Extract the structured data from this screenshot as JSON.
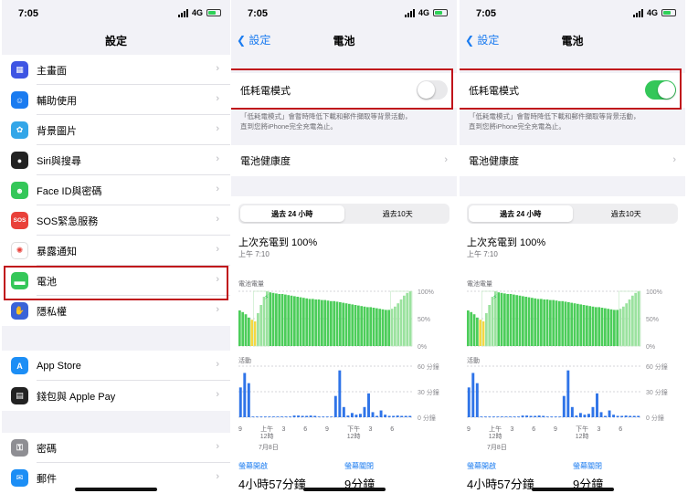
{
  "status": {
    "time": "7:05",
    "network": "4G"
  },
  "settings": {
    "title": "設定",
    "group1": [
      {
        "label": "主畫面",
        "icon": "home-grid-icon",
        "color": "#3f55e3"
      },
      {
        "label": "輔助使用",
        "icon": "accessibility-icon",
        "color": "#1a7bf0"
      },
      {
        "label": "背景圖片",
        "icon": "wallpaper-flower-icon",
        "color": "#33a6e8"
      },
      {
        "label": "Siri與搜尋",
        "icon": "siri-icon",
        "color": "#222"
      },
      {
        "label": "Face ID與密碼",
        "icon": "face-id-icon",
        "color": "#34c759"
      },
      {
        "label": "SOS緊急服務",
        "icon": "sos-icon",
        "color": "#e9413a",
        "glyph": "SOS"
      },
      {
        "label": "暴露通知",
        "icon": "exposure-icon",
        "color": "#ffffff"
      },
      {
        "label": "電池",
        "icon": "battery-icon",
        "color": "#34c759"
      },
      {
        "label": "隱私權",
        "icon": "hand-icon",
        "color": "#3a63d8"
      }
    ],
    "group2": [
      {
        "label": "App Store",
        "icon": "app-store-icon",
        "color": "#1c8ef5"
      },
      {
        "label": "錢包與 Apple Pay",
        "icon": "wallet-icon",
        "color": "#222"
      }
    ],
    "group3": [
      {
        "label": "密碼",
        "icon": "key-icon",
        "color": "#8e8e93"
      },
      {
        "label": "郵件",
        "icon": "mail-icon",
        "color": "#1c8ef5"
      }
    ]
  },
  "battery": {
    "back_label": "設定",
    "title": "電池",
    "low_power_label": "低耗電模式",
    "low_power_note_1": "「低耗電模式」會暫時降低下載和郵件擷取等背景活動，",
    "low_power_note_2": "直到您將iPhone完全充電為止。",
    "health_label": "電池健康度",
    "tab_24h": "過去 24 小時",
    "tab_10d": "過去10天",
    "last_charged": "上次充電到 100%",
    "last_time": "上午 7:10",
    "level_label": "電池電量",
    "activity_label": "活動",
    "level_ticks": [
      "100%",
      "50%",
      "0%"
    ],
    "activity_ticks": [
      "60 分鐘",
      "30 分鐘",
      "0 分鐘"
    ],
    "x_ticks": [
      "9",
      "上午\n12時",
      "3",
      "6",
      "9",
      "下午\n12時",
      "3",
      "6"
    ],
    "date_label": "7月8日",
    "screen_on_label": "螢幕開啟",
    "screen_off_label": "螢幕關閉",
    "screen_on_value": "4小時57分鐘",
    "screen_off_value": "9分鐘",
    "screen2_toggle_on": false,
    "screen3_toggle_on": true
  },
  "chart_data": [
    {
      "type": "area",
      "title": "電池電量",
      "ylim": [
        0,
        100
      ],
      "y_ticks": [
        "100%",
        "50%",
        "0%"
      ],
      "x_ticks": [
        "9",
        "上午 12時",
        "3",
        "6",
        "9",
        "下午 12時",
        "3",
        "6"
      ],
      "values": [
        65,
        62,
        58,
        52,
        48,
        45,
        60,
        75,
        90,
        100,
        98,
        97,
        96,
        95,
        95,
        94,
        93,
        92,
        91,
        90,
        89,
        88,
        87,
        86,
        86,
        85,
        85,
        84,
        84,
        83,
        82,
        82,
        81,
        80,
        79,
        78,
        77,
        76,
        75,
        74,
        73,
        72,
        71,
        71,
        70,
        69,
        68,
        67,
        66,
        66,
        68,
        72,
        78,
        85,
        92,
        97,
        100
      ],
      "charging_ranges": [
        [
          5,
          9
        ],
        [
          50,
          56
        ]
      ]
    },
    {
      "type": "bar",
      "title": "活動",
      "ylim": [
        0,
        60
      ],
      "y_ticks": [
        "60 分鐘",
        "30 分鐘",
        "0 分鐘"
      ],
      "values": [
        35,
        52,
        40,
        0,
        0,
        0,
        0,
        0,
        0,
        0,
        0,
        0,
        0,
        2,
        2,
        1,
        1,
        2,
        1,
        0,
        0,
        0,
        0,
        25,
        55,
        12,
        2,
        5,
        3,
        4,
        12,
        28,
        6,
        1,
        8,
        3,
        1,
        1,
        2,
        1,
        1,
        1
      ]
    }
  ]
}
